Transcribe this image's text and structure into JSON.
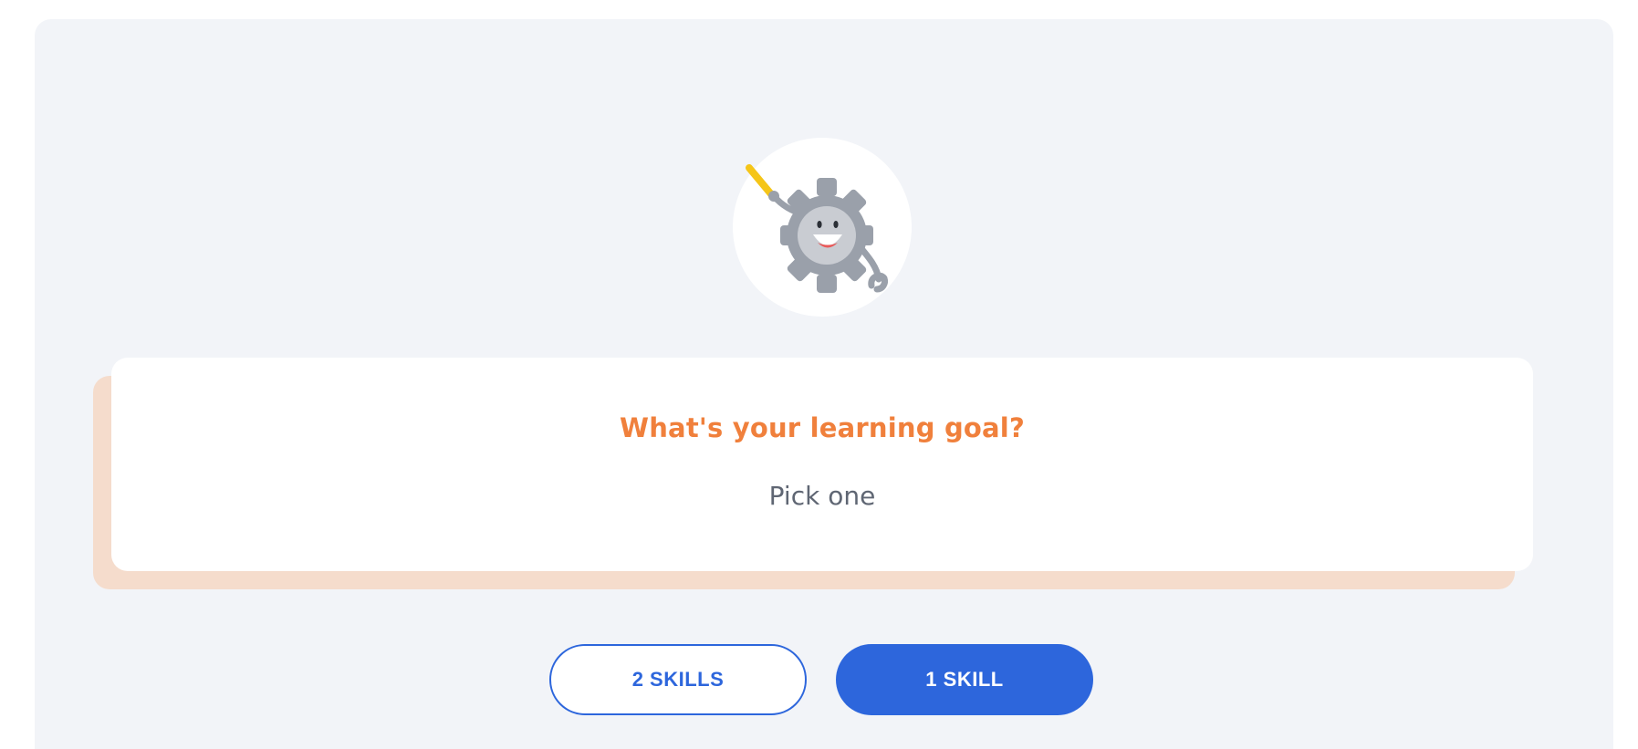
{
  "goal_card": {
    "title": "What's your learning goal?",
    "subtitle": "Pick one"
  },
  "options": {
    "two_skills_label": "2 SKILLS",
    "one_skill_label": "1 SKILL"
  },
  "mascot": {
    "icon": "gear-mascot-icon",
    "colors": {
      "gear": "#9aa0aa",
      "gear_inner": "#c9ccd2",
      "pencil": "#f5c518",
      "mouth": "#e85a5a"
    }
  },
  "colors": {
    "accent": "#2d66dc",
    "title": "#f0803c",
    "card_shadow": "#f5dccc",
    "panel_background": "#f2f4f8"
  }
}
